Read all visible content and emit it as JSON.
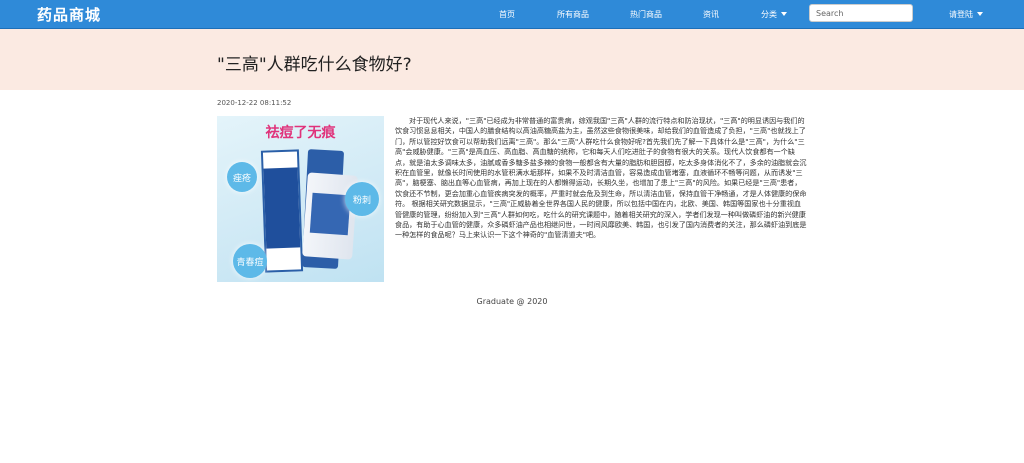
{
  "navbar": {
    "brand": "药品商城",
    "items": [
      "首页",
      "所有商品",
      "热门商品",
      "资讯"
    ],
    "category": "分类",
    "search_placeholder": "Search",
    "login": "请登陆"
  },
  "article": {
    "title": "\"三高\"人群吃什么食物好?",
    "date": "2020-12-22 08:11:52",
    "image": {
      "headline": "祛痘了无痕",
      "tags": [
        "痤疮",
        "粉刺",
        "青春痘"
      ]
    },
    "body": "对于现代人来说，\"三高\"已经成为非常普通的富贵病，综观我国\"三高\"人群的流行特点和防治现状，\"三高\"的明显诱因与我们的饮食习惯息息相关，中国人的膳食结构以高油高糖高盐为主，虽然这些食物很美味，却给我们的血管造成了负担，\"三高\"也就找上了门，所以管控好饮食可以帮助我们远离\"三高\"。那么\"三高\"人群吃什么食物好呢?首先我们先了解一下具体什么是\"三高\"，为什么\"三高\"会威胁健康。\"三高\"是高血压、高血脂、高血糖的统称，它和每天人们吃进肚子的食物有很大的关系。现代人饮食都有一个缺点，就是油太多调味太多，油腻咸香多糖多盐多辣的食物一般都含有大量的脂肪和胆固醇，吃太多身体消化不了，多余的油脂就会沉积在血管里，就像长时间使用的水管积满水垢那样，如果不及时清洁血管，容易造成血管堵塞，血液循环不畅等问题，从而诱发\"三高\"，脑梗塞、脑出血等心血管病，再加上现在的人都懒得运动，长期久坐，也增加了患上\"三高\"的风险。如果已经是\"三高\"患者，饮食还不节制，更会加重心血管疾病突发的概率，严重时就会危及到生命，所以清洁血管，保持血管干净畅通，才是人体健康的保命符。 根据相关研究数据显示，\"三高\"正威胁着全世界各国人民的健康，所以包括中国在内，北欧、美国、韩国等国家也十分重视血管健康的管理，纷纷加入到\"三高\"人群如何吃，吃什么的研究课题中，随着相关研究的深入，学者们发现一种叫做磷虾油的新兴健康食品，有助于心血管的健康，众多磷虾油产品也相继问世，一时间风靡欧美、韩国，也引发了国内消费者的关注，那么磷虾油到底是一种怎样的食品呢？马上来认识一下这个神奇的\"血管清道夫\"吧。"
  },
  "footer": {
    "text": "Graduate @ 2020"
  },
  "colors": {
    "navbar": "#2f8ad8",
    "hero": "#fbeae2",
    "image_headline": "#e0337b"
  }
}
